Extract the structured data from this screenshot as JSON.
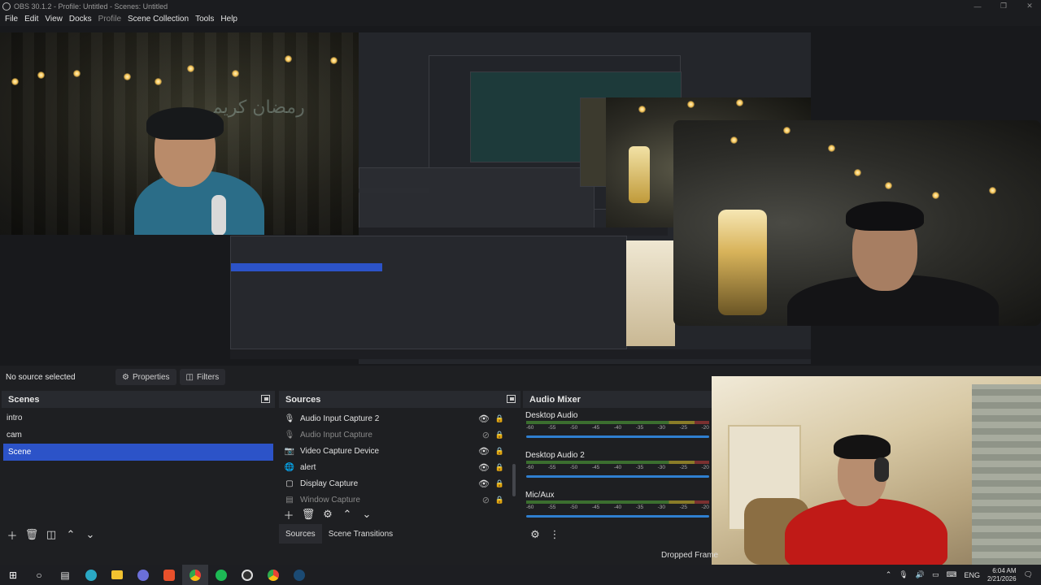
{
  "window": {
    "title": "OBS 30.1.2 - Profile: Untitled - Scenes: Untitled"
  },
  "menu": {
    "items": [
      "File",
      "Edit",
      "View",
      "Docks",
      "Profile",
      "Scene Collection",
      "Tools",
      "Help"
    ]
  },
  "preview": {
    "arabic_text": "رمضان كريم"
  },
  "source_bar": {
    "status": "No source selected",
    "properties_label": "Properties",
    "filters_label": "Filters"
  },
  "scenes": {
    "title": "Scenes",
    "items": [
      "intro",
      "cam",
      "Scene"
    ],
    "selected": "Scene"
  },
  "sources": {
    "title": "Sources",
    "items": [
      {
        "name": "Audio Input Capture 2",
        "icon": "microphone-icon",
        "visible": true
      },
      {
        "name": "Audio Input Capture",
        "icon": "microphone-icon",
        "visible": false
      },
      {
        "name": "Video Capture Device",
        "icon": "camera-icon",
        "visible": true
      },
      {
        "name": "alert",
        "icon": "globe-icon",
        "visible": true
      },
      {
        "name": "Display Capture",
        "icon": "monitor-icon",
        "visible": true
      },
      {
        "name": "Window Capture",
        "icon": "window-icon",
        "visible": false
      }
    ],
    "tabs": [
      "Sources",
      "Scene Transitions"
    ]
  },
  "audio_mixer": {
    "title": "Audio Mixer",
    "channels": [
      {
        "name": "Desktop Audio"
      },
      {
        "name": "Desktop Audio 2"
      },
      {
        "name": "Mic/Aux"
      }
    ],
    "scale": [
      "-60",
      "-55",
      "-50",
      "-45",
      "-40",
      "-35",
      "-30",
      "-25",
      "-20"
    ]
  },
  "status": {
    "dropped_frames": "Dropped Frame"
  },
  "taskbar": {
    "language": "ENG",
    "time": "6:04 AM",
    "date": "2/21/2026"
  },
  "colors": {
    "selected": "#2c53c8",
    "background": "#1e1f22",
    "panel_header": "#282a2f",
    "volume": "#2f7fd0"
  }
}
